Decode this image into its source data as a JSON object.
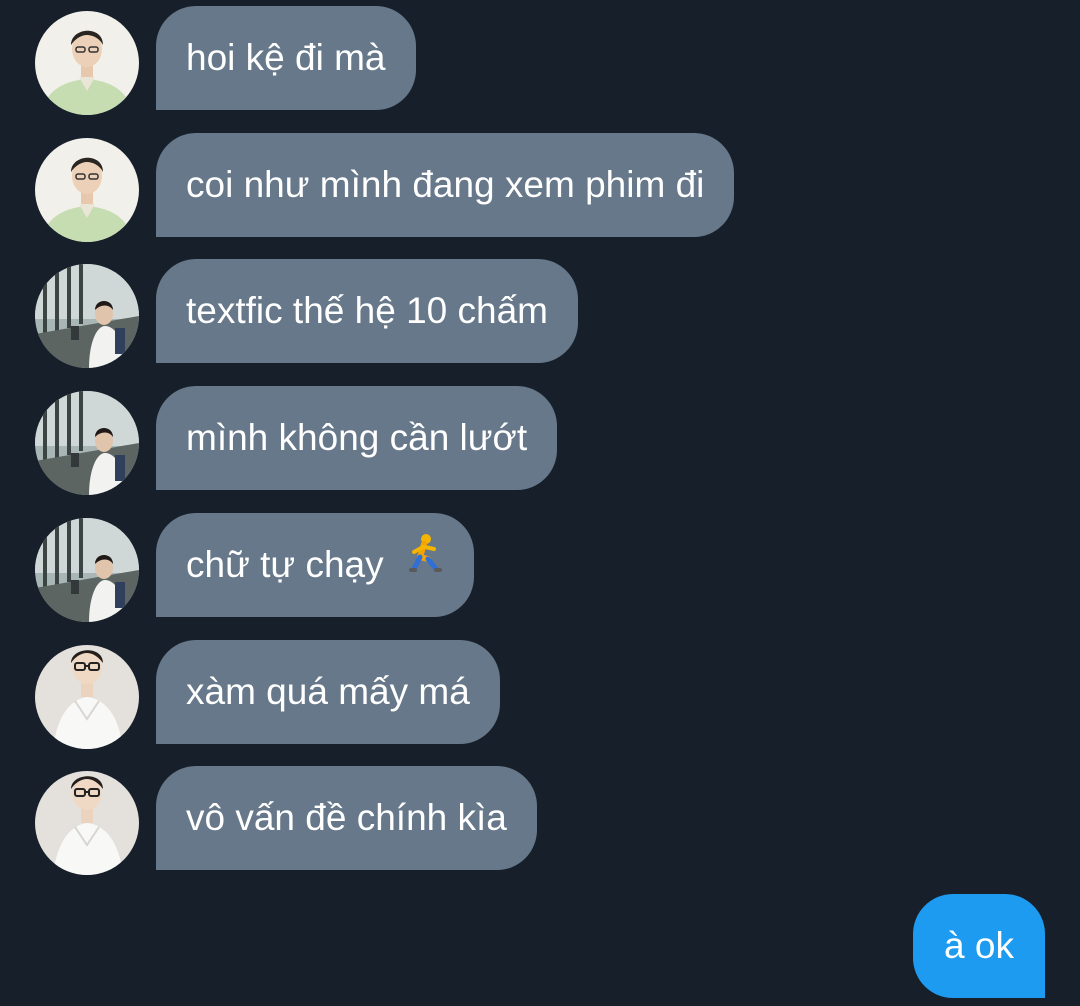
{
  "conversation": {
    "received": [
      {
        "text": "hoi kệ đi mà",
        "avatar": "green-shirt-avatar"
      },
      {
        "text": "coi như mình đang xem phim đi",
        "avatar": "green-shirt-avatar"
      },
      {
        "text": "textfic thế hệ 10 chấm",
        "avatar": "hallway-avatar"
      },
      {
        "text": "mình không cần lướt",
        "avatar": "hallway-avatar"
      },
      {
        "text": "chữ tự chạy",
        "avatar": "hallway-avatar",
        "emoji": "running-person-emoji"
      },
      {
        "text": "xàm quá mấy má",
        "avatar": "white-shirt-glasses-avatar"
      },
      {
        "text": "vô vấn đề chính kìa",
        "avatar": "white-shirt-glasses-avatar"
      }
    ],
    "sent": [
      {
        "text": "à ok"
      }
    ]
  },
  "colors": {
    "background": "#17202a",
    "received_bubble": "#66788a",
    "sent_bubble": "#1d9bf0",
    "text": "#ffffff"
  }
}
